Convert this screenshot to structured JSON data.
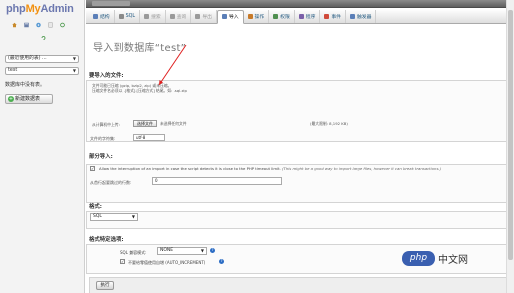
{
  "app": {
    "logo_php": "php",
    "logo_my": "My",
    "logo_admin": "Admin"
  },
  "nav": {
    "db_select": "(最近使用的表) ...",
    "table_select": "test",
    "note": "数据库中没有表。",
    "create_table": "新建数据表",
    "icons": [
      "home-icon",
      "sql-icon",
      "settings-icon",
      "docs-icon",
      "refresh-icon",
      "reload-icon"
    ]
  },
  "tabs": [
    {
      "label": "结构",
      "state": "normal"
    },
    {
      "label": "SQL",
      "state": "normal"
    },
    {
      "label": "搜索",
      "state": "dim"
    },
    {
      "label": "查询",
      "state": "dim"
    },
    {
      "label": "导出",
      "state": "dim"
    },
    {
      "label": "导入",
      "state": "active"
    },
    {
      "label": "操作",
      "state": "normal"
    },
    {
      "label": "权限",
      "state": "normal"
    },
    {
      "label": "程序",
      "state": "normal"
    },
    {
      "label": "事件",
      "state": "normal"
    },
    {
      "label": "触发器",
      "state": "normal"
    }
  ],
  "page": {
    "title": "导入到数据库“test”"
  },
  "file_section": {
    "legend": "要导入的文件:",
    "line1": "文件可能已压缩 (gzip, bzip2, zip) 或未压缩。",
    "line2": "压缩文件名必须以 .[格式].[压缩方式] 结尾。如: .sql.zip",
    "from_computer": "从计算机中上传:",
    "choose_file": "选择文件",
    "no_file": "未选择任何文件",
    "max_size": "(最大限制: 8,192 KB)",
    "charset_label": "文件的字符集:",
    "charset_value": "utf-8"
  },
  "partial": {
    "legend": "部分导入:",
    "interrupt_text": "Allow the interruption of an import in case the script detects it is close to the PHP timeout limit.",
    "interrupt_hint": "(This might be a good way to import large files, however it can break transactions.)",
    "interrupt_checked": true,
    "skip_label": "从首行起要跳过的行数:",
    "skip_value": "0"
  },
  "format": {
    "legend": "格式:",
    "value": "SQL"
  },
  "options": {
    "legend": "格式特定选项:",
    "compat_label": "SQL 兼容模式:",
    "compat_value": "NONE",
    "autoinc_label": "不要给零值使用自增 (AUTO_INCREMENT)",
    "autoinc_checked": true
  },
  "go_button": "执行",
  "watermark": {
    "badge": "php",
    "text": "中文网"
  },
  "colors": {
    "accent": "#235a81",
    "annotation": "#e02020",
    "logo_blue": "#6c78af",
    "logo_orange": "#f29111"
  }
}
